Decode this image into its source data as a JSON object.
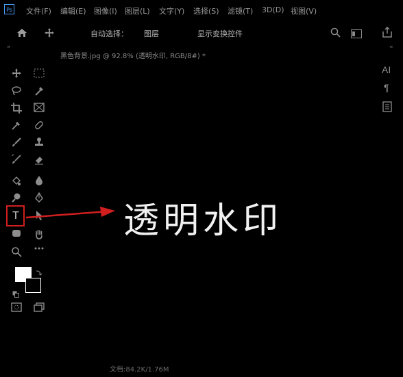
{
  "app": {
    "logo": "Ps"
  },
  "menu": [
    "文件(F)",
    "编辑(E)",
    "图像(I)",
    "图层(L)",
    "文字(Y)",
    "选择(S)",
    "滤镜(T)",
    "3D(D)",
    "视图(V)"
  ],
  "options_bar": {
    "auto_select_label": "自动选择：",
    "auto_select_value": "图层",
    "show_transform_label": "显示变换控件"
  },
  "document": {
    "tab_title": "黑色背景.jpg @ 92.8% (透明水印, RGB/8#) *"
  },
  "canvas": {
    "watermark_text": "透明水印"
  },
  "status_bar": {
    "text": "文档:84.2K/1.76M"
  },
  "swatches": {
    "foreground": "#ffffff",
    "background": "#000000"
  },
  "colors": {
    "highlight": "#d11f1f",
    "app_bg": "#000000",
    "icon": "#8d8d8d"
  },
  "icons": {
    "home": "home-icon",
    "move": "move-icon",
    "search": "search-icon",
    "workspace": "workspace-icon",
    "share": "share-icon",
    "panel_char": "AI",
    "panel_para": "¶"
  }
}
